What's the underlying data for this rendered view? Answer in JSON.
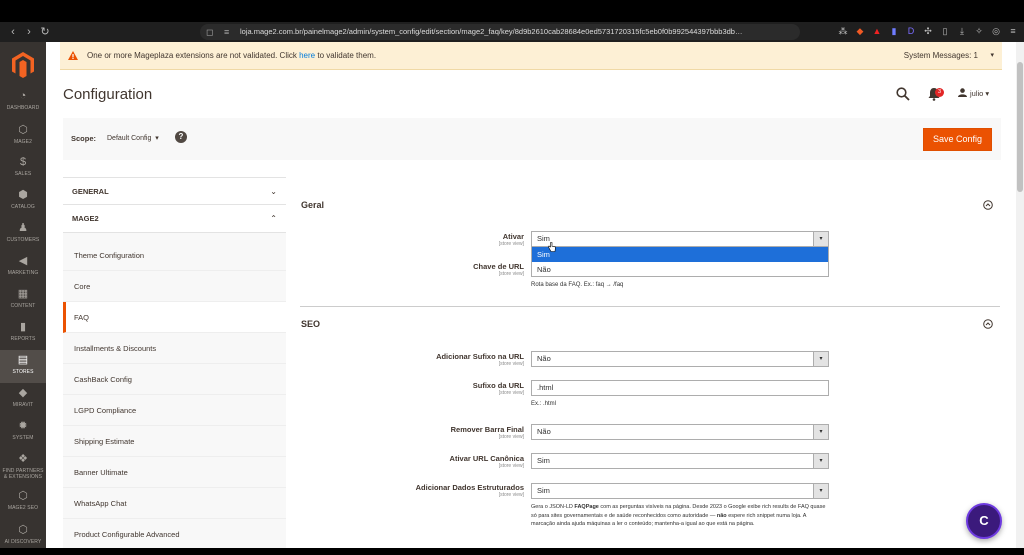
{
  "browser": {
    "url": "loja.mage2.com.br/painelmage2/admin/system_config/edit/section/mage2_faq/key/8d9b2610cab28684e0ed5731720315fc5eb0f0b992544397bbb3db…"
  },
  "sidebar": {
    "items": [
      {
        "icon": "dashboard-icon",
        "label": "DASHBOARD"
      },
      {
        "icon": "cube-icon",
        "label": "MAGE2"
      },
      {
        "icon": "dollar-icon",
        "label": "SALES"
      },
      {
        "icon": "box-icon",
        "label": "CATALOG"
      },
      {
        "icon": "person-icon",
        "label": "CUSTOMERS"
      },
      {
        "icon": "megaphone-icon",
        "label": "MARKETING"
      },
      {
        "icon": "content-icon",
        "label": "CONTENT"
      },
      {
        "icon": "bar-chart-icon",
        "label": "REPORTS"
      },
      {
        "icon": "store-icon",
        "label": "STORES"
      },
      {
        "icon": "diamond-icon",
        "label": "MIRAVIT"
      },
      {
        "icon": "gear-icon",
        "label": "SYSTEM"
      },
      {
        "icon": "puzzle-icon",
        "label": "FIND PARTNERS & EXTENSIONS"
      },
      {
        "icon": "seo-icon",
        "label": "MAGE2 SEO"
      },
      {
        "icon": "ai-icon",
        "label": "AI DISCOVERY"
      }
    ]
  },
  "notice": {
    "text_before": "One or more Mageplaza extensions are not validated. Click ",
    "link": "here",
    "text_after": " to validate them.",
    "system_messages": "System Messages: 1"
  },
  "header": {
    "title": "Configuration",
    "notification_count": "3",
    "user": "julio"
  },
  "scope": {
    "label": "Scope:",
    "value": "Default Config",
    "help": "?"
  },
  "actions": {
    "save": "Save Config"
  },
  "tabs": {
    "general": "GENERAL",
    "mage2": "MAGE2",
    "items": [
      "Theme Configuration",
      "Core",
      "FAQ",
      "Installments & Discounts",
      "CashBack Config",
      "LGPD Compliance",
      "Shipping Estimate",
      "Banner Ultimate",
      "WhatsApp Chat",
      "Product Configurable Advanced"
    ],
    "active": "FAQ"
  },
  "geral": {
    "title": "Geral",
    "ativar": {
      "label": "Ativar",
      "scope": "[store view]",
      "value": "Sim",
      "options": [
        "Sim",
        "Não"
      ]
    },
    "chave": {
      "label": "Chave de URL",
      "scope": "[store view]",
      "note": "Rota base da FAQ. Ex.: faq → /faq"
    }
  },
  "seo": {
    "title": "SEO",
    "sufixo_ativo": {
      "label": "Adicionar Sufixo na URL",
      "scope": "[store view]",
      "value": "Não"
    },
    "sufixo": {
      "label": "Sufixo da URL",
      "scope": "[store view]",
      "value": ".html",
      "note": "Ex.: .html"
    },
    "barra": {
      "label": "Remover Barra Final",
      "scope": "[store view]",
      "value": "Não"
    },
    "canonica": {
      "label": "Ativar URL Canônica",
      "scope": "[store view]",
      "value": "Sim"
    },
    "dados": {
      "label": "Adicionar Dados Estruturados",
      "scope": "[store view]",
      "value": "Sim",
      "note_1": "Gera o JSON-LD ",
      "note_code": "FAQPage",
      "note_2": " com as perguntas visíveis na página. Desde 2023 o Google exibe rich results de FAQ quase só para sites governamentais e de saúde reconhecidos como autoridade — ",
      "note_bold": "não",
      "note_3": " espere rich snippet numa loja. A marcação ainda ajuda máquinas a ler o conteúdo; mantenha-a igual ao que está na página."
    }
  },
  "chat": {
    "label": "C"
  },
  "colors": {
    "accent": "#eb5202",
    "sidebar": "#373330",
    "select_highlight": "#1e6fd9"
  }
}
